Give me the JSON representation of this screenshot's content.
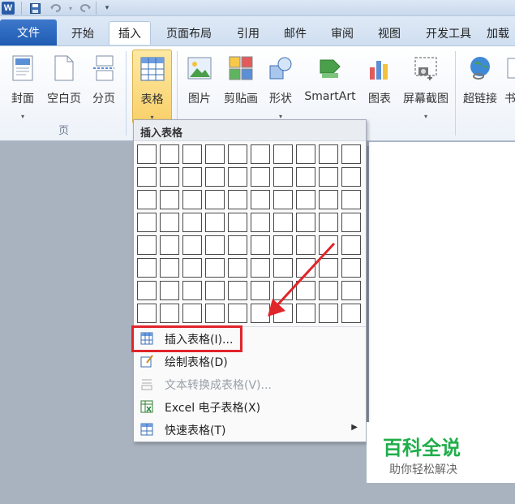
{
  "app": {
    "logo": "W"
  },
  "quick_access": {
    "save_icon": "save-icon",
    "undo_icon": "undo-icon",
    "redo_icon": "redo-icon",
    "dropdown": "▾"
  },
  "tabs": [
    {
      "label": "文件",
      "active": false
    },
    {
      "label": "开始",
      "active": false
    },
    {
      "label": "插入",
      "active": true
    },
    {
      "label": "页面布局",
      "active": false
    },
    {
      "label": "引用",
      "active": false
    },
    {
      "label": "邮件",
      "active": false
    },
    {
      "label": "审阅",
      "active": false
    },
    {
      "label": "视图",
      "active": false
    },
    {
      "label": "开发工具",
      "active": false
    },
    {
      "label": "加载",
      "active": false
    }
  ],
  "ribbon": {
    "pages_group": {
      "label": "页",
      "buttons": [
        {
          "label": "封面",
          "icon": "cover-page-icon",
          "has_dropdown": true
        },
        {
          "label": "空白页",
          "icon": "blank-page-icon",
          "has_dropdown": false
        },
        {
          "label": "分页",
          "icon": "page-break-icon",
          "has_dropdown": false
        }
      ]
    },
    "table_button": {
      "label": "表格",
      "icon": "table-icon",
      "has_dropdown": true,
      "active": true
    },
    "illustrations": [
      {
        "label": "图片",
        "icon": "picture-icon",
        "has_dropdown": false
      },
      {
        "label": "剪贴画",
        "icon": "clipart-icon",
        "has_dropdown": false
      },
      {
        "label": "形状",
        "icon": "shapes-icon",
        "has_dropdown": true
      },
      {
        "label": "SmartArt",
        "icon": "smartart-icon",
        "has_dropdown": false
      },
      {
        "label": "图表",
        "icon": "chart-icon",
        "has_dropdown": false
      },
      {
        "label": "屏幕截图",
        "icon": "screenshot-icon",
        "has_dropdown": true
      }
    ],
    "links": [
      {
        "label": "超链接",
        "icon": "hyperlink-icon"
      },
      {
        "label": "书",
        "icon": "bookmark-icon"
      }
    ]
  },
  "dropdown": {
    "title": "插入表格",
    "grid": {
      "columns": 10,
      "rows": 8
    },
    "items": [
      {
        "label": "插入表格(I)...",
        "icon": "insert-table-icon",
        "disabled": false,
        "submenu": false,
        "highlighted": true
      },
      {
        "label": "绘制表格(D)",
        "icon": "draw-table-icon",
        "disabled": false,
        "submenu": false,
        "highlighted": false
      },
      {
        "label": "文本转换成表格(V)...",
        "icon": "text-to-table-icon",
        "disabled": true,
        "submenu": false,
        "highlighted": false
      },
      {
        "label": "Excel 电子表格(X)",
        "icon": "excel-icon",
        "disabled": false,
        "submenu": false,
        "highlighted": false
      },
      {
        "label": "快速表格(T)",
        "icon": "quick-table-icon",
        "disabled": false,
        "submenu": true,
        "highlighted": false
      }
    ],
    "submenu_arrow": "▶"
  },
  "watermark": {
    "title": "百科全说",
    "subtitle": "助你轻松解决"
  },
  "colors": {
    "highlight": "#e0252b",
    "accent_tab": "#2b63b8",
    "watermark": "#1fae4a"
  }
}
